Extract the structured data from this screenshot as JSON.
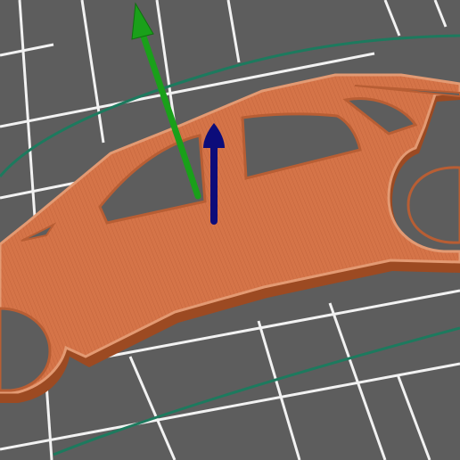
{
  "viewport": {
    "background_color": "#5d5d5d",
    "grid_color": "#f2f2f2",
    "travel_path_color": "#1d7a5e",
    "part": {
      "name": "car-silhouette-keychain",
      "fill_color": "#d8784e",
      "edge_color": "#9c4a22",
      "perimeter_color": "#e39a73"
    },
    "gizmo": {
      "y_axis_color": "#1aa01a",
      "z_axis_color": "#0c0c7a",
      "y_icon": "green-arrow-icon",
      "z_icon": "blue-arrow-icon"
    }
  }
}
